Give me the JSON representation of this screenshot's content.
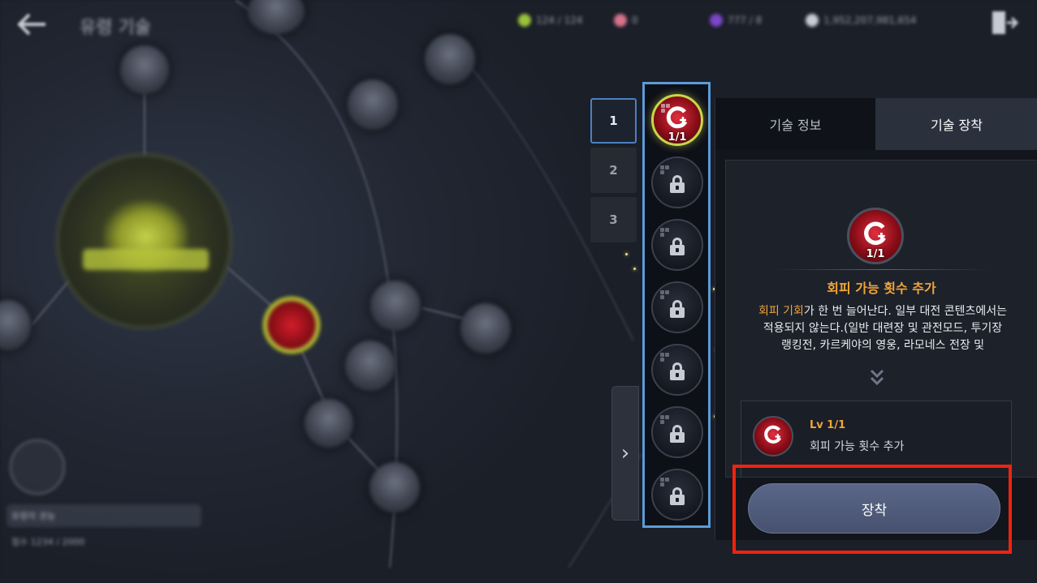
{
  "header": {
    "page_title": "유령 기술",
    "currencies": [
      {
        "icon": "green-gem-icon",
        "value": "124 / 124",
        "color": "#9bc23b"
      },
      {
        "icon": "pink-crystal-icon",
        "value": "0",
        "color": "#d8738a"
      },
      {
        "icon": "purple-gem-icon",
        "value": "777 / 8",
        "color": "#7b46c9"
      },
      {
        "icon": "silver-coin-icon",
        "value": "1,952,207,981,654",
        "color": "#c7ccd6"
      }
    ]
  },
  "bottom_left": {
    "preset_label": "유령의 권능",
    "points_text": "점수 1234 / 2000"
  },
  "preset_tabs": [
    "1",
    "2",
    "3"
  ],
  "active_preset": "1",
  "slots": [
    {
      "state": "equipped",
      "level": "1/1"
    },
    {
      "state": "locked"
    },
    {
      "state": "locked"
    },
    {
      "state": "locked"
    },
    {
      "state": "locked"
    },
    {
      "state": "locked"
    },
    {
      "state": "locked"
    }
  ],
  "panel": {
    "tabs": {
      "info": "기술 정보",
      "equip": "기술 장착"
    },
    "active_tab": "equip",
    "skill": {
      "level_badge": "1/1",
      "name": "회피 가능 횟수 추가",
      "desc_highlight": "회피 기회",
      "desc_line1_rest": "가 한 번 늘어난다. 일부 대전 콘텐츠에서는",
      "desc_line2": "적용되지 않는다.(일반 대련장 및 관전모드, 투기장",
      "desc_line3": "랭킹전, 카르케야의 영웅, 라모네스 전장 및"
    },
    "level_card": {
      "level": "Lv 1/1",
      "desc": "회피 가능 횟수 추가"
    },
    "equip_button": "장착"
  },
  "colors": {
    "accent_blue": "#5c9bd8",
    "highlight_red": "#f0230e",
    "skill_gold": "#f0a53a"
  }
}
